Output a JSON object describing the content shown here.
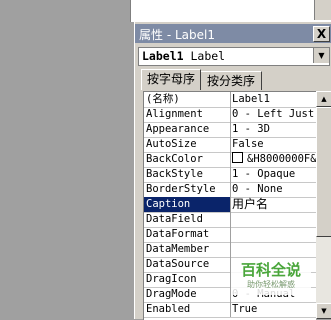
{
  "window": {
    "title": "属性 - Label1",
    "close_glyph": "X"
  },
  "object_combo": {
    "name": "Label1",
    "type": "Label",
    "arrow_glyph": "▼"
  },
  "tabs": [
    {
      "label": "按字母序",
      "active": true
    },
    {
      "label": "按分类序",
      "active": false
    }
  ],
  "properties": [
    {
      "name": "(名称)",
      "value": "Label1"
    },
    {
      "name": "Alignment",
      "value": "0 - Left Just"
    },
    {
      "name": "Appearance",
      "value": "1 - 3D"
    },
    {
      "name": "AutoSize",
      "value": "False"
    },
    {
      "name": "BackColor",
      "value": "&H8000000F&",
      "swatch": "#ffffff"
    },
    {
      "name": "BackStyle",
      "value": "1 - Opaque"
    },
    {
      "name": "BorderStyle",
      "value": "0 - None"
    },
    {
      "name": "Caption",
      "value": "用户名",
      "selected": true
    },
    {
      "name": "DataField",
      "value": ""
    },
    {
      "name": "DataFormat",
      "value": ""
    },
    {
      "name": "DataMember",
      "value": ""
    },
    {
      "name": "DataSource",
      "value": ""
    },
    {
      "name": "DragIcon",
      "value": ""
    },
    {
      "name": "DragMode",
      "value": "0 - Manual"
    },
    {
      "name": "Enabled",
      "value": "True"
    }
  ],
  "scrollbar": {
    "up_glyph": "▲",
    "down_glyph": "▼"
  },
  "watermark": {
    "title": "百科全说",
    "subtitle": "助你轻松解惑"
  },
  "colors": {
    "titlebar": "#7e8ba5",
    "selection": "#0a246a",
    "watermark_green": "#4aa63b"
  }
}
